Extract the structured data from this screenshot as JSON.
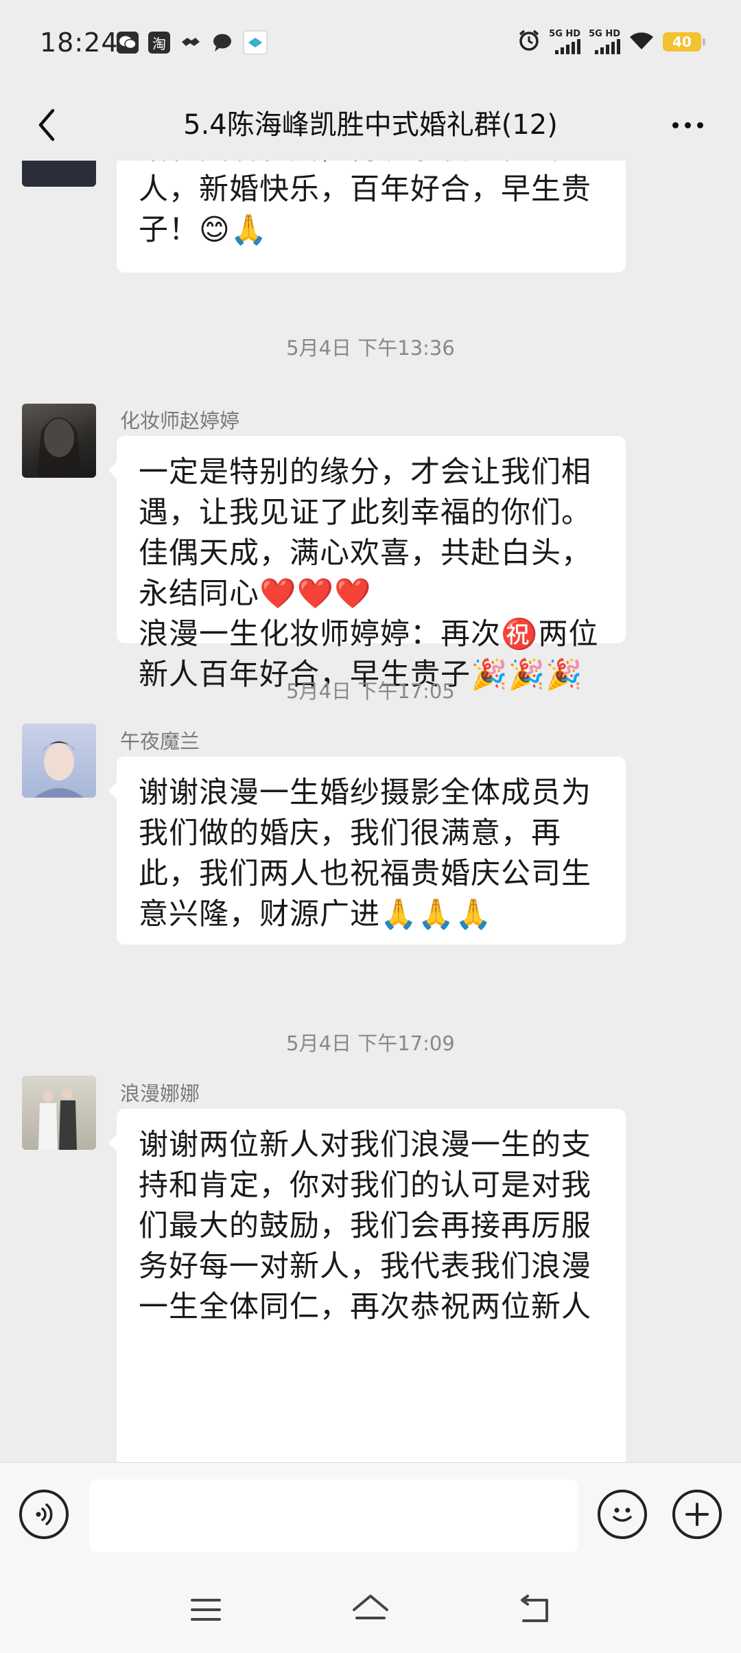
{
  "status_bar": {
    "time": "18:24",
    "apps": [
      "wechat-icon",
      "taobao-icon",
      "handshake-icon",
      "message-icon",
      "app-icon"
    ],
    "taobao_label": "淘",
    "network_1": "5G HD",
    "network_2": "5G HD",
    "battery": "40"
  },
  "header": {
    "title": "5.4陈海峰凯胜中式婚礼群(12)"
  },
  "messages": [
    {
      "text": "婚礼圆满礼成，再次恭祝二位新人，新婚快乐，百年好合，早生贵子！😊🙏"
    },
    {
      "timestamp": "5月4日 下午13:36",
      "sender": "化妆师赵婷婷",
      "text": "一定是特别的缘分，才会让我们相遇，让我见证了此刻幸福的你们。佳偶天成，满心欢喜，共赴白头，永结同心❤️❤️❤️\n浪漫一生化妆师婷婷：再次㊗️两位新人百年好合，早生贵子🎉🎉🎉"
    },
    {
      "timestamp": "5月4日 下午17:05",
      "sender": "午夜魔兰",
      "text": "谢谢浪漫一生婚纱摄影全体成员为我们做的婚庆，我们很满意，再此，我们两人也祝福贵婚庆公司生意兴隆，财源广进🙏🙏🙏"
    },
    {
      "timestamp": "5月4日 下午17:09",
      "sender": "浪漫娜娜",
      "text": "谢谢两位新人对我们浪漫一生的支持和肯定，你对我们的认可是对我们最大的鼓励，我们会再接再厉服务好每一对新人，我代表我们浪漫一生全体同仁，再次恭祝两位新人"
    }
  ],
  "input": {
    "value": "",
    "placeholder": ""
  },
  "icons": {
    "voice": "voice-icon",
    "emoji": "emoji-icon",
    "plus": "plus-icon",
    "menu": "menu-icon",
    "home": "home-icon",
    "back": "back-icon"
  }
}
